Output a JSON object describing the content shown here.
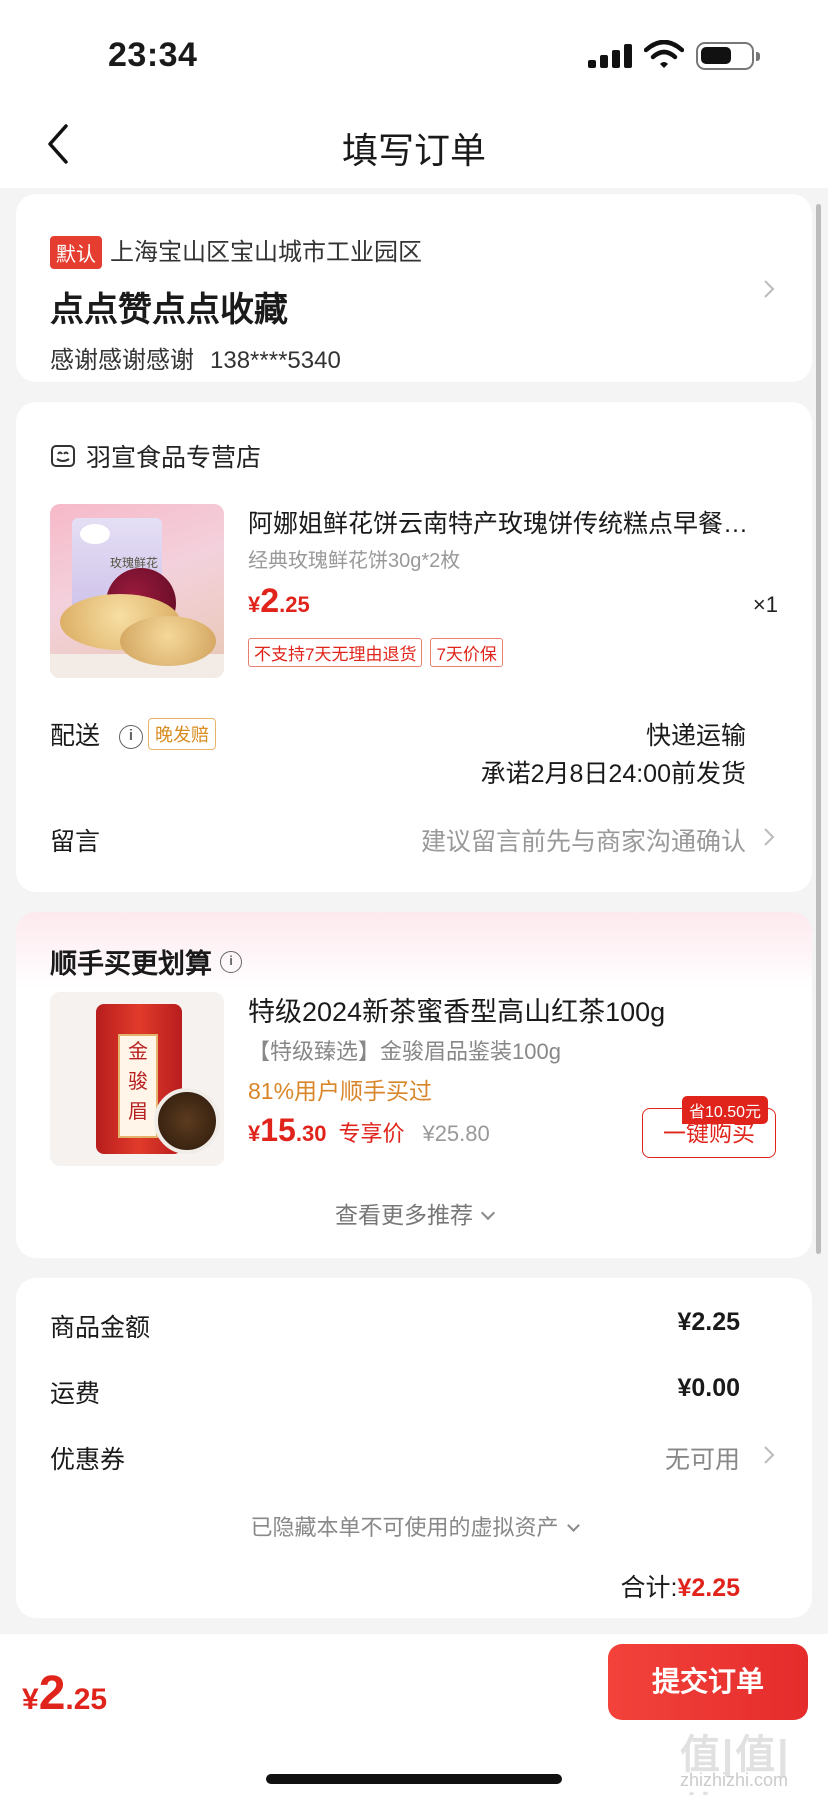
{
  "status_bar": {
    "time": "23:34"
  },
  "nav": {
    "title": "填写订单"
  },
  "address": {
    "default_tag": "默认",
    "region": "上海宝山区宝山城市工业园区",
    "detail": "点点赞点点收藏",
    "receiver": "感谢感谢感谢",
    "phone": "138****5340"
  },
  "store": {
    "name": "羽宣食品专营店"
  },
  "product": {
    "title": "阿娜姐鲜花饼云南特产玫瑰饼传统糕点早餐…",
    "spec": "经典玫瑰鲜花饼30g*2枚",
    "currency": "¥",
    "price_int": "2",
    "price_dec": ".25",
    "qty": "×1",
    "tags": [
      "不支持7天无理由退货",
      "7天价保"
    ]
  },
  "delivery": {
    "label": "配送",
    "late_tag": "晚发赔",
    "method": "快递运输",
    "promise": "承诺2月8日24:00前发货"
  },
  "message": {
    "label": "留言",
    "placeholder": "建议留言前先与商家沟通确认"
  },
  "recommend": {
    "title": "顺手买更划算",
    "name": "特级2024新茶蜜香型高山红茶100g",
    "sub": "【特级臻选】金骏眉品鉴装100g",
    "bought": "81%用户顺手买过",
    "currency": "¥",
    "price_int": "15",
    "price_dec": ".30",
    "exclusive_label": "专享价",
    "orig_price": "¥25.80",
    "save_badge": "省10.50元",
    "buy_label": "一键购买",
    "more_label": "查看更多推荐",
    "can_text": [
      "金",
      "骏",
      "眉"
    ]
  },
  "summary": {
    "goods_label": "商品金额",
    "goods_value": "¥2.25",
    "shipping_label": "运费",
    "shipping_value": "¥0.00",
    "coupon_label": "优惠券",
    "coupon_value": "无可用",
    "hidden_assets": "已隐藏本单不可使用的虚拟资产",
    "total_label": "合计:",
    "total_value": "¥2.25"
  },
  "bottom_bar": {
    "currency": "¥",
    "price_int": "2",
    "price_dec": ".25",
    "submit_label": "提交订单"
  },
  "watermark": {
    "big": "值|值|值",
    "small": "zhizhizhi.com"
  },
  "colors": {
    "accent": "#e0241b",
    "warning": "#d9862a"
  }
}
